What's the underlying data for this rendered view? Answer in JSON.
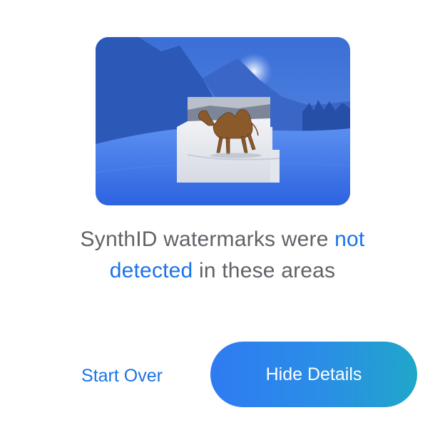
{
  "preview": {
    "image_description": "camel-in-snow-photo"
  },
  "result": {
    "prefix": "SynthID watermarks were ",
    "highlight": "not detected",
    "suffix": " in these areas",
    "highlight_color": "#1a73e8",
    "text_color": "#5f6368"
  },
  "actions": {
    "start_over_label": "Start Over",
    "hide_details_label": "Hide Details"
  },
  "colors": {
    "overlay_blue": "#2f6fe0",
    "button_gradient_start": "#2f7bf2",
    "button_gradient_end": "#20a7c9"
  }
}
